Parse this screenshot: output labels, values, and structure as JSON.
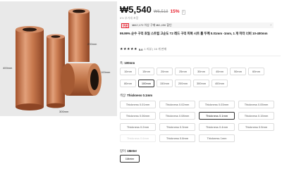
{
  "product": {
    "price": "₩5,540",
    "original_price": "₩6,518",
    "discount": "15%",
    "stock_icon": "info-icon",
    "tax_note": "6% 부가세 포함",
    "coupon": {
      "tag": "쿠폰",
      "text": "₩42,170 이상 구매 ₩1,456 할인",
      "arrow": "›"
    },
    "title": "99.99% 순수 구리 호일 스트립 고순도 T2 레드 구리 피복 시트 롤 두께 0.01mm -1mm, 1 개 미터 너비 10-400mm",
    "rating": {
      "value": "5.0",
      "meta": "1 리뷰 | 16 개 판매",
      "stars": 5
    }
  },
  "image_labels": {
    "left_height": "400mm",
    "bottom_width": "300mm",
    "right_top": "200mm",
    "right_mid": "100mm"
  },
  "options": {
    "width": {
      "label": "폭: ",
      "selected": "100mm",
      "items": [
        "10mm",
        "15mm",
        "20mm",
        "25mm",
        "30mm",
        "40mm",
        "50mm",
        "60mm",
        "80mm",
        "100mm",
        "150mm",
        "200mm",
        "300mm",
        "400mm"
      ]
    },
    "color": {
      "label": "색상: ",
      "selected": "Thickness 0.1mm",
      "items": [
        "Thickness 0.01mm",
        "Thickness 0.02mm",
        "Thickness 0.03mm",
        "Thickness 0.05mm",
        "Thickness 0.06mm",
        "Thickness 0.08mm",
        "Thickness 0.1mm",
        "Thickness 0.15mm",
        "Thickness 0.2mm",
        "Thickness 0.3mm",
        "Thickness 0.4mm",
        "Thickness 0.5mm",
        "Thickness 0.6mm",
        "Thickness 0.8mm",
        "Thickness 1mm"
      ]
    },
    "length": {
      "label": "길이: ",
      "selected": "1Meter",
      "items": [
        "1Meter"
      ]
    }
  }
}
